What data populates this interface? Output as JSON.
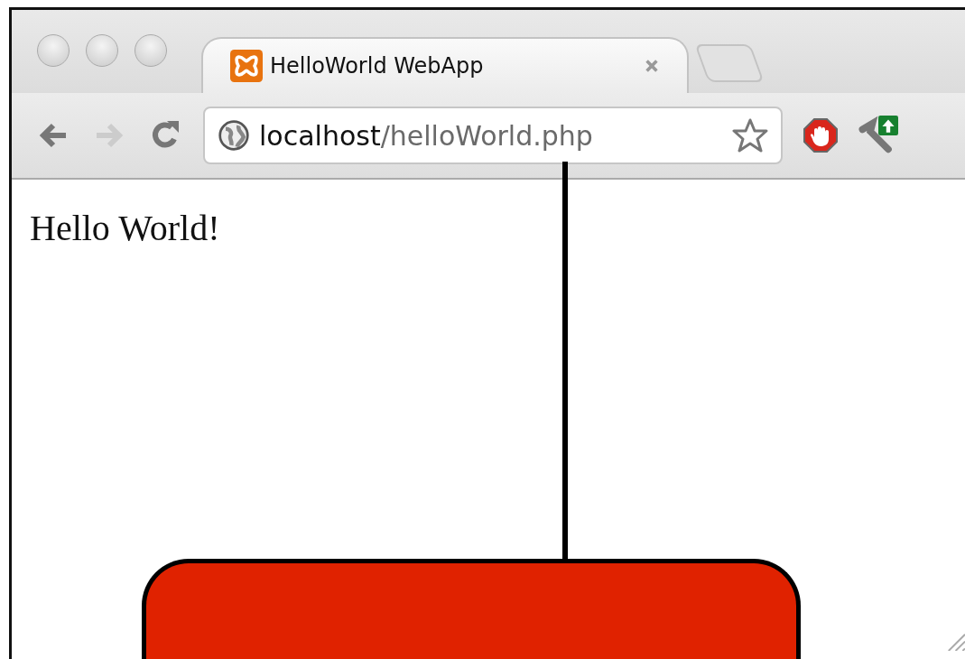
{
  "tabs": [
    {
      "title": "HelloWorld WebApp",
      "selected": true
    }
  ],
  "toolbar": {
    "back": {
      "disabled": false
    },
    "forward": {
      "disabled": true
    },
    "address": {
      "host": "localhost",
      "path": "/helloWorld.php"
    }
  },
  "page": {
    "text": "Hello World!"
  }
}
